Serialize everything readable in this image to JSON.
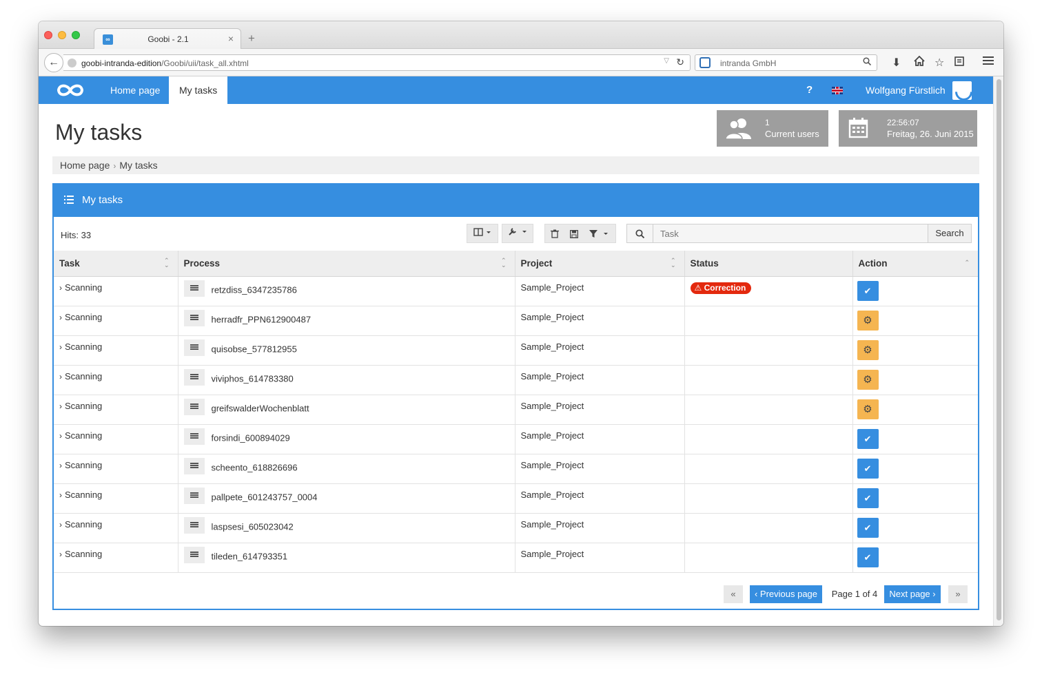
{
  "browser": {
    "tab_title": "Goobi - 2.1",
    "tab_close": "×",
    "new_tab": "+",
    "url_host": "goobi-intranda-edition",
    "url_path": "/Goobi/uii/task_all.xhtml",
    "search_engine_text": "intranda GmbH"
  },
  "app": {
    "nav": [
      "Home page",
      "My tasks"
    ],
    "help": "?",
    "username": "Wolfgang Fürstlich",
    "accent_color": "#368ee0"
  },
  "header": {
    "title": "My tasks",
    "users_count": "1",
    "users_label": "Current users",
    "time": "22:56:07",
    "date": "Freitag, 26. Juni 2015"
  },
  "breadcrumb": [
    "Home page",
    "My tasks"
  ],
  "box": {
    "title": "My tasks",
    "hits": "Hits: 33",
    "search_placeholder": "Task",
    "search_button": "Search"
  },
  "table": {
    "columns": [
      "Task",
      "Process",
      "Project",
      "Status",
      "Action"
    ],
    "rows": [
      {
        "task": "Scanning",
        "process": "retzdiss_6347235786",
        "project": "Sample_Project",
        "status": "Correction",
        "action": "accept"
      },
      {
        "task": "Scanning",
        "process": "herradfr_PPN612900487",
        "project": "Sample_Project",
        "status": "",
        "action": "settings"
      },
      {
        "task": "Scanning",
        "process": "quisobse_577812955",
        "project": "Sample_Project",
        "status": "",
        "action": "settings"
      },
      {
        "task": "Scanning",
        "process": "viviphos_614783380",
        "project": "Sample_Project",
        "status": "",
        "action": "settings"
      },
      {
        "task": "Scanning",
        "process": "greifswalderWochenblatt",
        "project": "Sample_Project",
        "status": "",
        "action": "settings"
      },
      {
        "task": "Scanning",
        "process": "forsindi_600894029",
        "project": "Sample_Project",
        "status": "",
        "action": "accept"
      },
      {
        "task": "Scanning",
        "process": "scheento_618826696",
        "project": "Sample_Project",
        "status": "",
        "action": "accept"
      },
      {
        "task": "Scanning",
        "process": "pallpete_601243757_0004",
        "project": "Sample_Project",
        "status": "",
        "action": "accept"
      },
      {
        "task": "Scanning",
        "process": "laspsesi_605023042",
        "project": "Sample_Project",
        "status": "",
        "action": "accept"
      },
      {
        "task": "Scanning",
        "process": "tileden_614793351",
        "project": "Sample_Project",
        "status": "",
        "action": "accept"
      }
    ]
  },
  "pagination": {
    "first": "«",
    "previous": "‹ Previous page",
    "page_label": "Page 1 of 4",
    "next": "Next page ›",
    "last": "»"
  }
}
